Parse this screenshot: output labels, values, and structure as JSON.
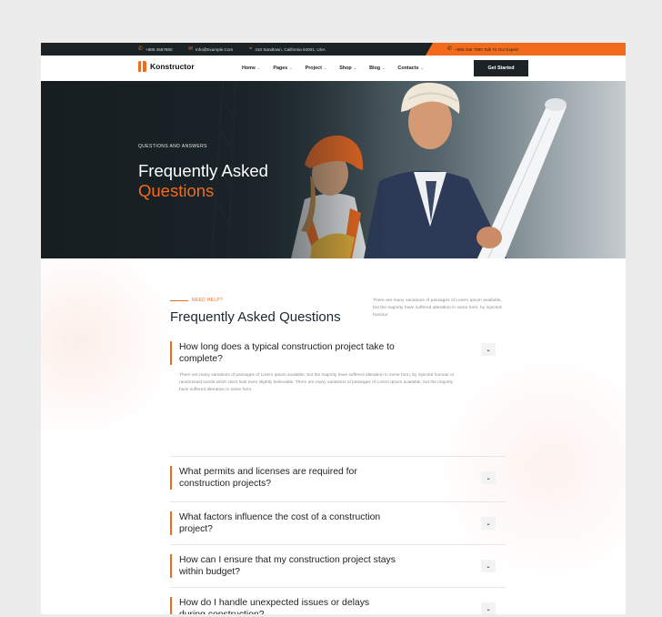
{
  "topbar": {
    "phone": "+888 4567890",
    "email": "Info@Example.Com",
    "address": "410 Sandtown, California 94001, USA",
    "expert": "+888 456 7890 Talk To Our Expert"
  },
  "nav": {
    "logo": "Konstructor",
    "items": [
      "Home",
      "Pages",
      "Project",
      "Shop",
      "Blog",
      "Contacts"
    ],
    "cta": "Get Started"
  },
  "hero": {
    "kicker": "QUESTIONS AND ANSWERS",
    "title_line1": "Frequently Asked",
    "title_line2": "Questions"
  },
  "faq_section": {
    "kicker": "NEED HELP?",
    "title": "Frequently Asked Questions",
    "description": "There are many variations of passages of Lorem Ipsum available, but the majority have suffered alteration in some form, by injected humour",
    "items": [
      {
        "question": "How long does a typical construction project take to complete?",
        "answer": "There are many variations of passages of Lorem Ipsum available, but the majority have suffered alteration in some form, by injected humour or randomised words which don't look even slightly believable. There are many variations of passages of Lorem Ipsum available, but the majority have suffered alteration in some form."
      },
      {
        "question": "What permits and licenses are required for construction projects?"
      },
      {
        "question": "What factors influence the cost of a construction project?"
      },
      {
        "question": "How can I ensure that my construction project stays within budget?"
      },
      {
        "question": "How do I handle unexpected issues or delays during construction?"
      }
    ]
  },
  "icons": {
    "phone": "phone-icon",
    "email": "mail-icon",
    "address": "location-icon",
    "toggle": "chevron-down-icon"
  },
  "colors": {
    "accent": "#f26b1d",
    "dark": "#1b2327"
  }
}
